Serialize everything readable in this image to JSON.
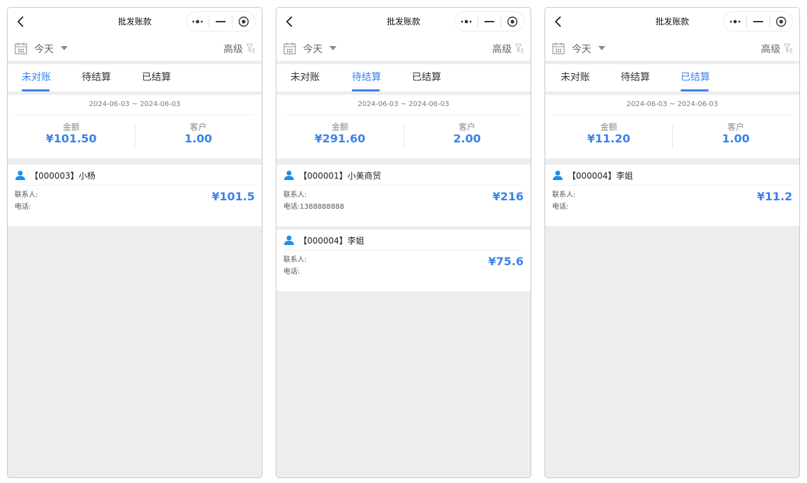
{
  "screens": [
    {
      "title": "批发账款",
      "date_filter": "今天",
      "advanced_label": "高级",
      "tabs": [
        "未对账",
        "待结算",
        "已结算"
      ],
      "active_tab": 0,
      "date_range": "2024-06-03 ~ 2024-06-03",
      "amount_label": "金额",
      "amount_value": "¥101.50",
      "customer_label": "客户",
      "customer_value": "1.00",
      "customers": [
        {
          "name": "【000003】小杨",
          "contact_label": "联系人:",
          "contact": "",
          "phone_label": "电话:",
          "phone": "",
          "amount": "¥101.5"
        }
      ]
    },
    {
      "title": "批发账款",
      "date_filter": "今天",
      "advanced_label": "高级",
      "tabs": [
        "未对账",
        "待结算",
        "已结算"
      ],
      "active_tab": 1,
      "date_range": "2024-06-03 ~ 2024-06-03",
      "amount_label": "金额",
      "amount_value": "¥291.60",
      "customer_label": "客户",
      "customer_value": "2.00",
      "customers": [
        {
          "name": "【000001】小美商贸",
          "contact_label": "联系人:",
          "contact": "",
          "phone_label": "电话:",
          "phone": "1388888888",
          "amount": "¥216"
        },
        {
          "name": "【000004】李姐",
          "contact_label": "联系人:",
          "contact": "",
          "phone_label": "电话:",
          "phone": "",
          "amount": "¥75.6"
        }
      ]
    },
    {
      "title": "批发账款",
      "date_filter": "今天",
      "advanced_label": "高级",
      "tabs": [
        "未对账",
        "待结算",
        "已结算"
      ],
      "active_tab": 2,
      "date_range": "2024-06-03 ~ 2024-06-03",
      "amount_label": "金额",
      "amount_value": "¥11.20",
      "customer_label": "客户",
      "customer_value": "1.00",
      "customers": [
        {
          "name": "【000004】李姐",
          "contact_label": "联系人:",
          "contact": "",
          "phone_label": "电话:",
          "phone": "",
          "amount": "¥11.2"
        }
      ]
    }
  ],
  "colors": {
    "accent": "#3a82ec",
    "person_icon": "#1890f0",
    "background": "#ededed"
  },
  "icons": {
    "back": "chevron-left-icon",
    "more": "more-dots-icon",
    "minimize": "minimize-icon",
    "close": "target-close-icon",
    "calendar": "calendar-icon",
    "dropdown": "caret-down-icon",
    "filter": "filter-icon",
    "person": "person-icon"
  }
}
